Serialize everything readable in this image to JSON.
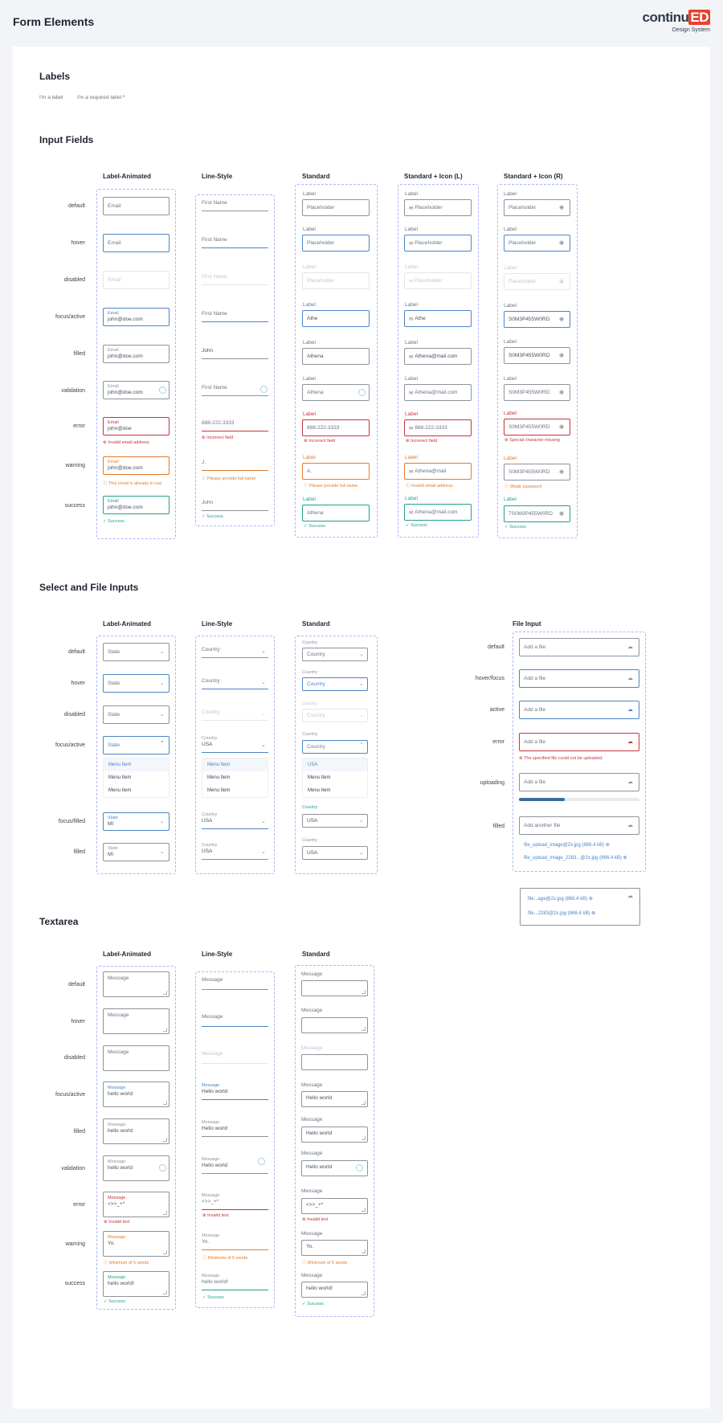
{
  "page_title": "Form Elements",
  "logo": {
    "word": "continu",
    "ed": "ED",
    "sub": "Design System"
  },
  "labels": {
    "title": "Labels",
    "plain": "I'm a label",
    "required": "I'm a required label",
    "required_mark": "*"
  },
  "input_fields": {
    "title": "Input Fields",
    "columns": [
      "Label-Animated",
      "Line-Style",
      "Standard",
      "Standard + Icon (L)",
      "Standard + Icon (R)"
    ],
    "rows": [
      "default",
      "hover",
      "disabled",
      "focus/active",
      "filled",
      "validation",
      "error",
      "warning",
      "success"
    ],
    "label_animated": {
      "field_label": "Email",
      "value": "john@doe.com",
      "error_value": "john@doe",
      "error_msg": "Invalid email address",
      "warning_msg": "This email is already in use",
      "success_msg": "Success"
    },
    "line_style": {
      "field_label": "First Name",
      "filled": "John",
      "error_value": "888-222-3333",
      "error_msg": "Incorrect field",
      "warning_value": "J.",
      "warning_msg": "Please provide full name",
      "success_value": "John",
      "success_msg": "Success"
    },
    "standard": {
      "label": "Label",
      "placeholder": "Placeholder",
      "focus_value": "Athe",
      "value": "Athena",
      "error_value": "888-222-3333",
      "error_msg": "Incorrect field",
      "warning_value": "A.",
      "warning_msg": "Please provide full name",
      "success_msg": "Success"
    },
    "icon_left": {
      "label": "Label",
      "placeholder": "Placeholder",
      "focus_value": "Athe",
      "value": "Athena@mail.com",
      "error_value": "888-222-3333",
      "error_msg": "Incorrect field",
      "warning_value": "Athena@mail",
      "warning_msg": "Invalid email address",
      "success_msg": "Success"
    },
    "icon_right": {
      "label": "Label",
      "placeholder": "Placeholder",
      "value": "S0M3P455W0RD",
      "error_msg": "Special character missing",
      "warning_msg": "Weak password",
      "success_value": "7S0M3P455W0RD",
      "success_msg": "Success"
    }
  },
  "select_file": {
    "title": "Select and File Inputs",
    "columns": [
      "Label-Animated",
      "Line-Style",
      "Standard",
      "File Input"
    ],
    "rows": [
      "default",
      "hover",
      "disabled",
      "focus/active",
      "focus/filled",
      "filled"
    ],
    "animated": {
      "label": "State",
      "value": "MI"
    },
    "line": {
      "label": "Country",
      "value": "USA"
    },
    "standard": {
      "label": "Country",
      "value": "USA"
    },
    "menu_items": [
      "Menu Item",
      "Menu Item",
      "Menu Item"
    ],
    "std_menu_items": [
      "USA",
      "Menu Item",
      "Menu Item"
    ],
    "file_rows": [
      "default",
      "hover/focus",
      "active",
      "error",
      "uploading",
      "filled"
    ],
    "file": {
      "placeholder": "Add a file",
      "add_another": "Add another file",
      "error_msg": "The specified file could not be uploaded.",
      "upload_progress": 0.38,
      "files": [
        "file_upload_image@2x.jpg (866.4 kB)",
        "file_upload_image_2283...@2x.jpg (866.4 kB)"
      ],
      "compact_files": [
        "file...age@2x.jpg (866.4 kB)",
        "file...2283@2x.jpg (866.4 kB)"
      ]
    }
  },
  "textarea": {
    "title": "Textarea",
    "columns": [
      "Label-Animated",
      "Line-Style",
      "Standard"
    ],
    "rows": [
      "default",
      "hover",
      "disabled",
      "focus/active",
      "filled",
      "validation",
      "error",
      "warning",
      "success"
    ],
    "label": "Message",
    "animated": {
      "focus": "hello world",
      "filled": "hello world",
      "error": "<>>_+*",
      "warning": "Yo.",
      "success": "hello world!"
    },
    "line": {
      "focus": "Hello world",
      "filled": "Hello world",
      "error": "<>>_+*",
      "warning": "Yo.",
      "success": "hello world!"
    },
    "standard": {
      "focus": "Hello world",
      "filled": "Hello world",
      "error": "<>>_+*",
      "warning": "Yo.",
      "success": "hello world!"
    },
    "error_msg": "Invalid text",
    "warning_msg": "Minimum of 5 words",
    "success_msg": "Success"
  },
  "colors": {
    "focus": "#4f84c4",
    "error": "#c4353a",
    "warning": "#e07b2c",
    "success": "#23a08a",
    "brand": "#e8412c"
  }
}
